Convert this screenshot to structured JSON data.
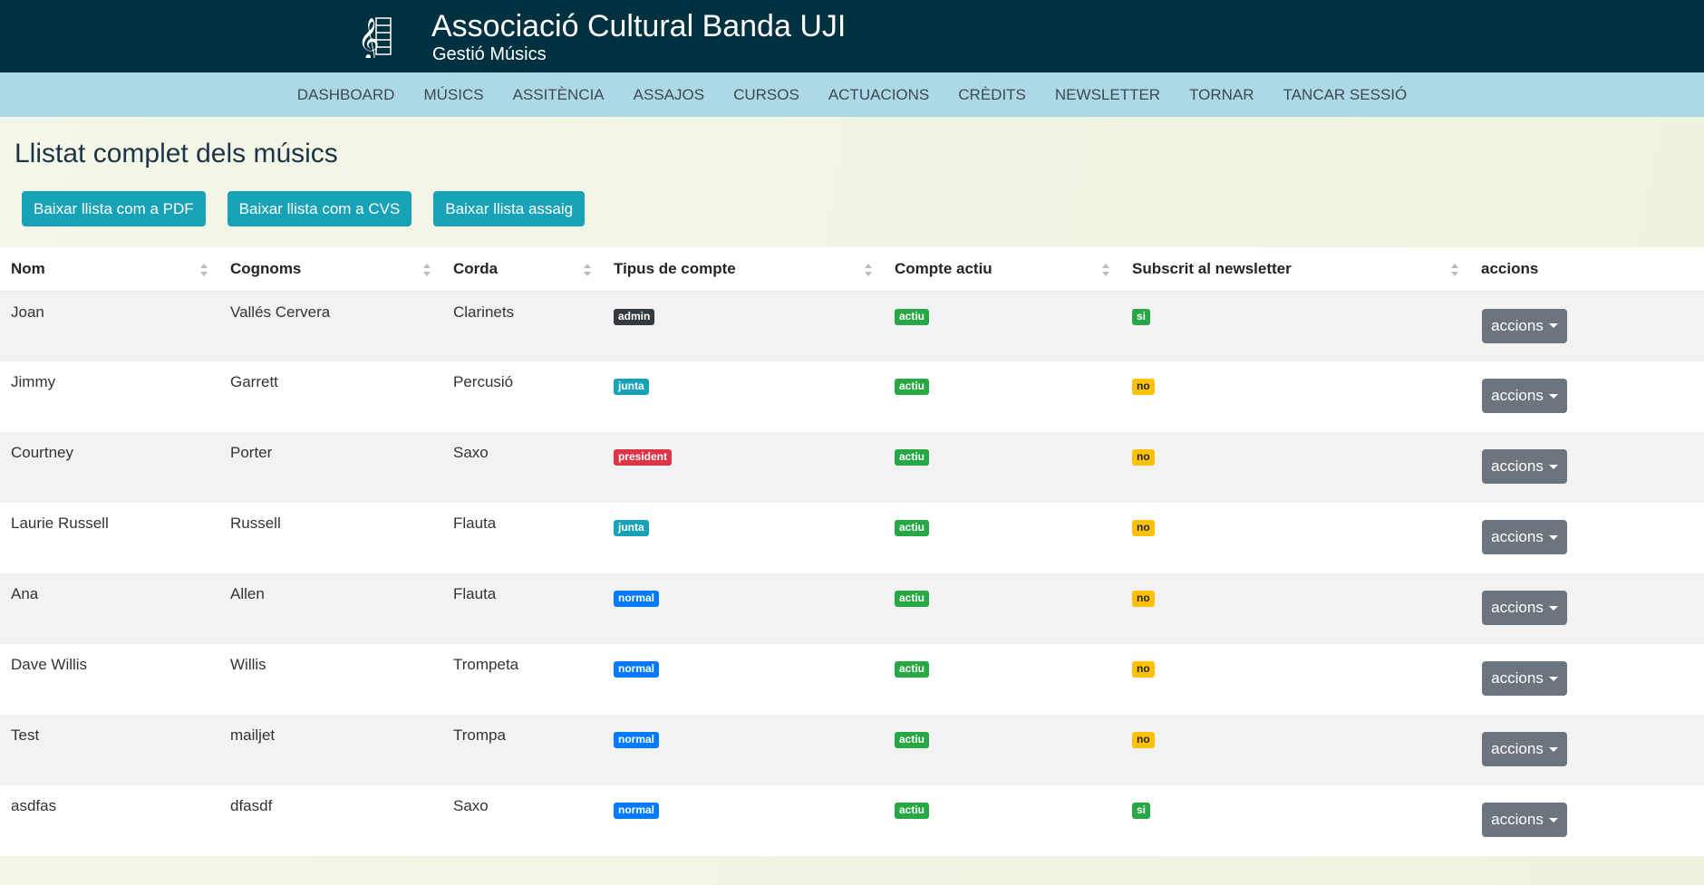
{
  "header": {
    "title": "Associació Cultural Banda UJI",
    "subtitle": "Gestió Músics"
  },
  "nav": [
    "DASHBOARD",
    "MÚSICS",
    "ASSITÈNCIA",
    "ASSAJOS",
    "CURSOS",
    "ACTUACIONS",
    "CRÈDITS",
    "NEWSLETTER",
    "TORNAR",
    "TANCAR SESSIÓ"
  ],
  "page_title": "Llistat complet dels músics",
  "buttons": {
    "pdf": "Baixar llista com a PDF",
    "cvs": "Baixar llista com a CVS",
    "assaig": "Baixar llista assaig"
  },
  "table": {
    "headers": {
      "nom": "Nom",
      "cognoms": "Cognoms",
      "corda": "Corda",
      "tipus": "Tipus de compte",
      "actiu": "Compte actiu",
      "newsletter": "Subscrit al newsletter",
      "accions": "accions"
    },
    "action_label": "accions",
    "rows": [
      {
        "nom": "Joan",
        "cognoms": "Vallés Cervera",
        "corda": "Clarinets",
        "tipus": "admin",
        "actiu": "actiu",
        "newsletter": "si"
      },
      {
        "nom": "Jimmy",
        "cognoms": "Garrett",
        "corda": "Percusió",
        "tipus": "junta",
        "actiu": "actiu",
        "newsletter": "no"
      },
      {
        "nom": "Courtney",
        "cognoms": "Porter",
        "corda": "Saxo",
        "tipus": "president",
        "actiu": "actiu",
        "newsletter": "no"
      },
      {
        "nom": "Laurie Russell",
        "cognoms": "Russell",
        "corda": "Flauta",
        "tipus": "junta",
        "actiu": "actiu",
        "newsletter": "no"
      },
      {
        "nom": "Ana",
        "cognoms": "Allen",
        "corda": "Flauta",
        "tipus": "normal",
        "actiu": "actiu",
        "newsletter": "no"
      },
      {
        "nom": "Dave Willis",
        "cognoms": "Willis",
        "corda": "Trompeta",
        "tipus": "normal",
        "actiu": "actiu",
        "newsletter": "no"
      },
      {
        "nom": "Test",
        "cognoms": "mailjet",
        "corda": "Trompa",
        "tipus": "normal",
        "actiu": "actiu",
        "newsletter": "no"
      },
      {
        "nom": "asdfas",
        "cognoms": "dfasdf",
        "corda": "Saxo",
        "tipus": "normal",
        "actiu": "actiu",
        "newsletter": "si"
      }
    ]
  },
  "colors": {
    "header_bg": "#003140",
    "nav_bg": "#add8e6",
    "info": "#17a2b8",
    "secondary": "#6c757d",
    "success": "#28a745",
    "warning": "#ffc107",
    "danger": "#dc3545",
    "primary": "#007bff",
    "dark": "#343a40"
  },
  "icons": {
    "logo": "treble-clef-logo",
    "sort": "sort-icon",
    "caret": "caret-down-icon"
  }
}
